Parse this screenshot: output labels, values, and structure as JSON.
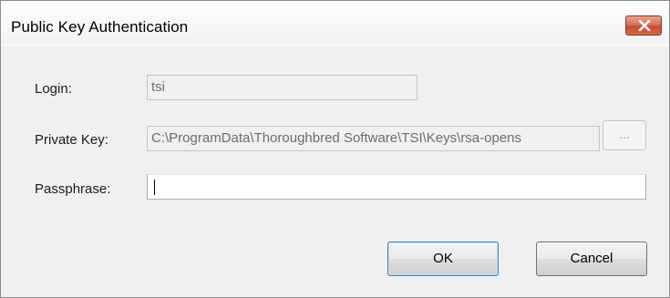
{
  "window": {
    "title": "Public Key Authentication"
  },
  "titlebar": {
    "close_icon": "close-x-icon"
  },
  "form": {
    "login_label": "Login:",
    "login_value": "tsi",
    "private_key_label": "Private Key:",
    "private_key_value": "C:\\ProgramData\\Thoroughbred Software\\TSI\\Keys\\rsa-opens",
    "browse_label": "...",
    "passphrase_label": "Passphrase:",
    "passphrase_value": ""
  },
  "buttons": {
    "ok_label": "OK",
    "cancel_label": "Cancel"
  },
  "colors": {
    "close_button": "#c84b30",
    "dialog_background": "#f0f0f0"
  }
}
